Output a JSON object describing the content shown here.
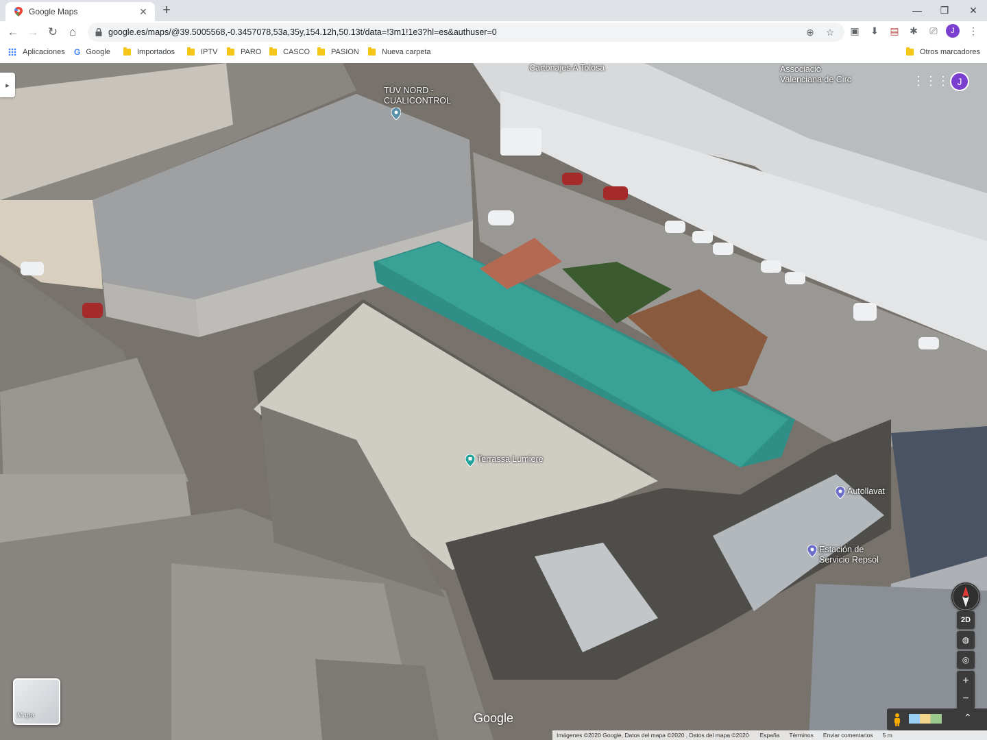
{
  "browser": {
    "tab_title": "Google Maps",
    "new_tab_label": "+",
    "url": "google.es/maps/@39.5005568,-0.3457078,53a,35y,154.12h,50.13t/data=!3m1!1e3?hl=es&authuser=0",
    "profile_initial": "J"
  },
  "bookmarks": {
    "apps": "Aplicaciones",
    "items": [
      "Google",
      "Importados",
      "IPTV",
      "PARO",
      "CASCO",
      "PASION",
      "Nueva carpeta"
    ],
    "other": "Otros marcadores"
  },
  "map": {
    "pois": [
      {
        "label": "TÜV NORD -\nCUALICONTROL",
        "icon": "pin-icon",
        "color": "#5a8fa8"
      },
      {
        "label": "Terrassa Lumiere",
        "icon": "pin-icon",
        "color": "#21a29a"
      },
      {
        "label": "Autollavat",
        "icon": "pin-icon",
        "color": "#6c6ec9"
      },
      {
        "label": "Estación de\nServicio Repsol",
        "icon": "pin-icon",
        "color": "#6c6ec9"
      }
    ],
    "place_labels": [
      "Cartonajes A Tolosa",
      "Associació\nValenciana de Circ"
    ],
    "account_initial": "J",
    "minimap_label": "Mapa",
    "google_logo": "Google",
    "toggle_2d": "2D",
    "zoom_in": "+",
    "zoom_out": "−",
    "footer": {
      "attribution": "Imágenes ©2020 Google, Datos del mapa ©2020 , Datos del mapa ©2020",
      "country": "España",
      "terms": "Términos",
      "feedback": "Enviar comentarios",
      "scale": "5 m"
    }
  }
}
